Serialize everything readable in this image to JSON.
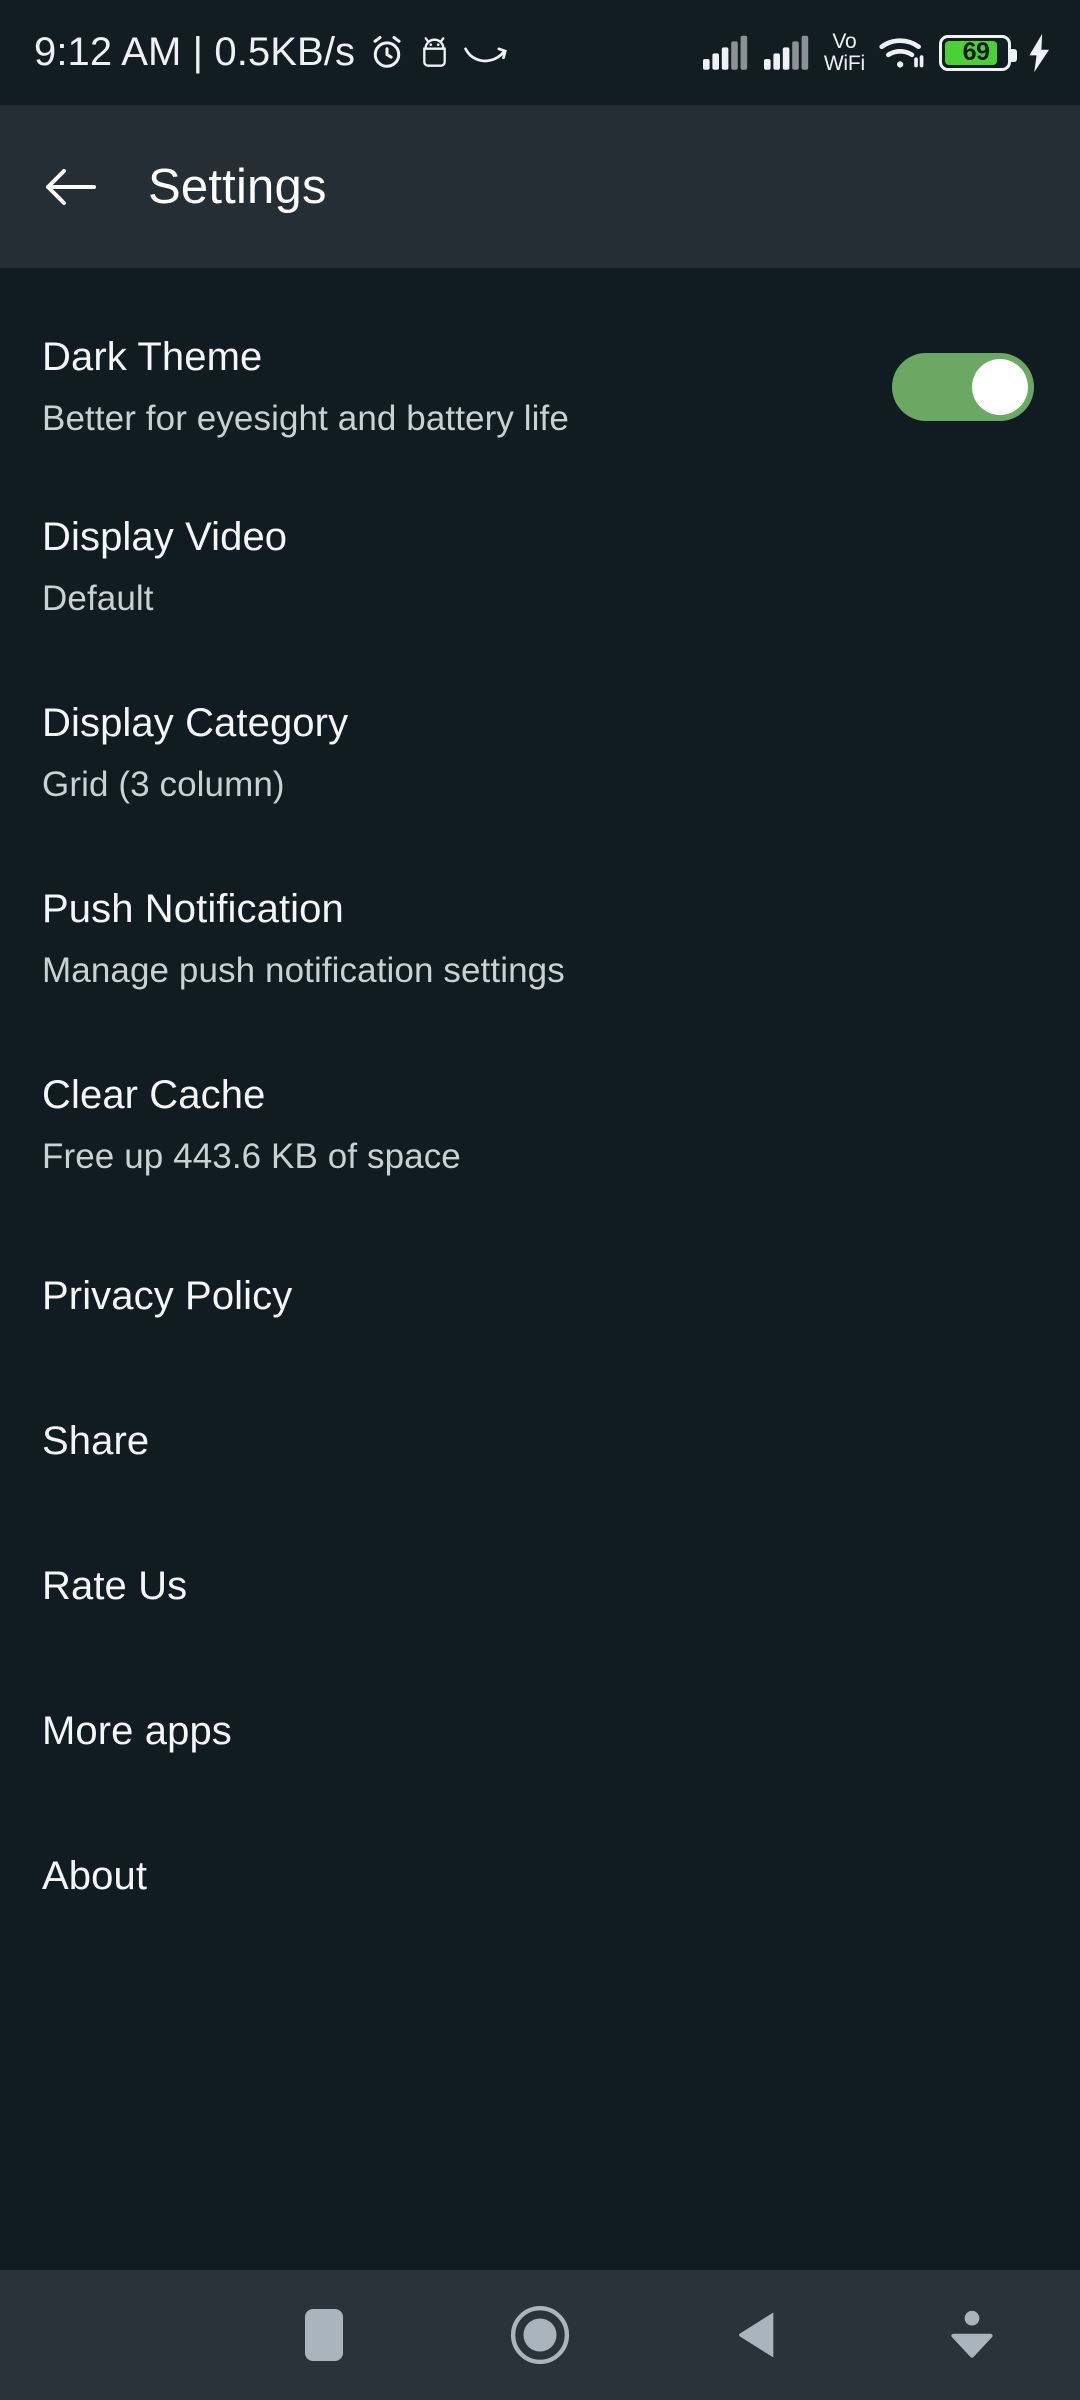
{
  "status_bar": {
    "clock": "9:12 AM | 0.5KB/s",
    "alarm_icon": "alarm-clock-icon",
    "android_icon": "android-head-icon",
    "swoosh_icon": "amazon-swoosh-icon",
    "signal_1_icon": "signal-bars-icon",
    "signal_2_icon": "signal-bars-icon",
    "volte_line1": "Vo",
    "volte_line2": "WiFi",
    "wifi_icon": "wifi-icon",
    "battery_level": "69",
    "charging_icon": "charging-bolt-icon",
    "battery_color": "#4cd038"
  },
  "app_bar": {
    "back_icon": "arrow-left-icon",
    "title": "Settings"
  },
  "settings": {
    "dark_theme": {
      "title": "Dark Theme",
      "subtitle": "Better for eyesight and battery life",
      "toggle_state": "on",
      "toggle_color": "#6aa863"
    },
    "display_video": {
      "title": "Display Video",
      "subtitle": "Default"
    },
    "display_category": {
      "title": "Display Category",
      "subtitle": "Grid (3 column)"
    },
    "push_notification": {
      "title": "Push Notification",
      "subtitle": "Manage push notification settings"
    },
    "clear_cache": {
      "title": "Clear Cache",
      "subtitle": "Free up 443.6 KB of space"
    },
    "privacy_policy": {
      "title": "Privacy Policy"
    },
    "share": {
      "title": "Share"
    },
    "rate_us": {
      "title": "Rate Us"
    },
    "more_apps": {
      "title": "More apps"
    },
    "about": {
      "title": "About"
    }
  },
  "nav_bar": {
    "recents_icon": "recents-square-icon",
    "home_icon": "home-circle-icon",
    "back_icon": "back-triangle-icon",
    "collapse_icon": "collapse-down-icon"
  }
}
